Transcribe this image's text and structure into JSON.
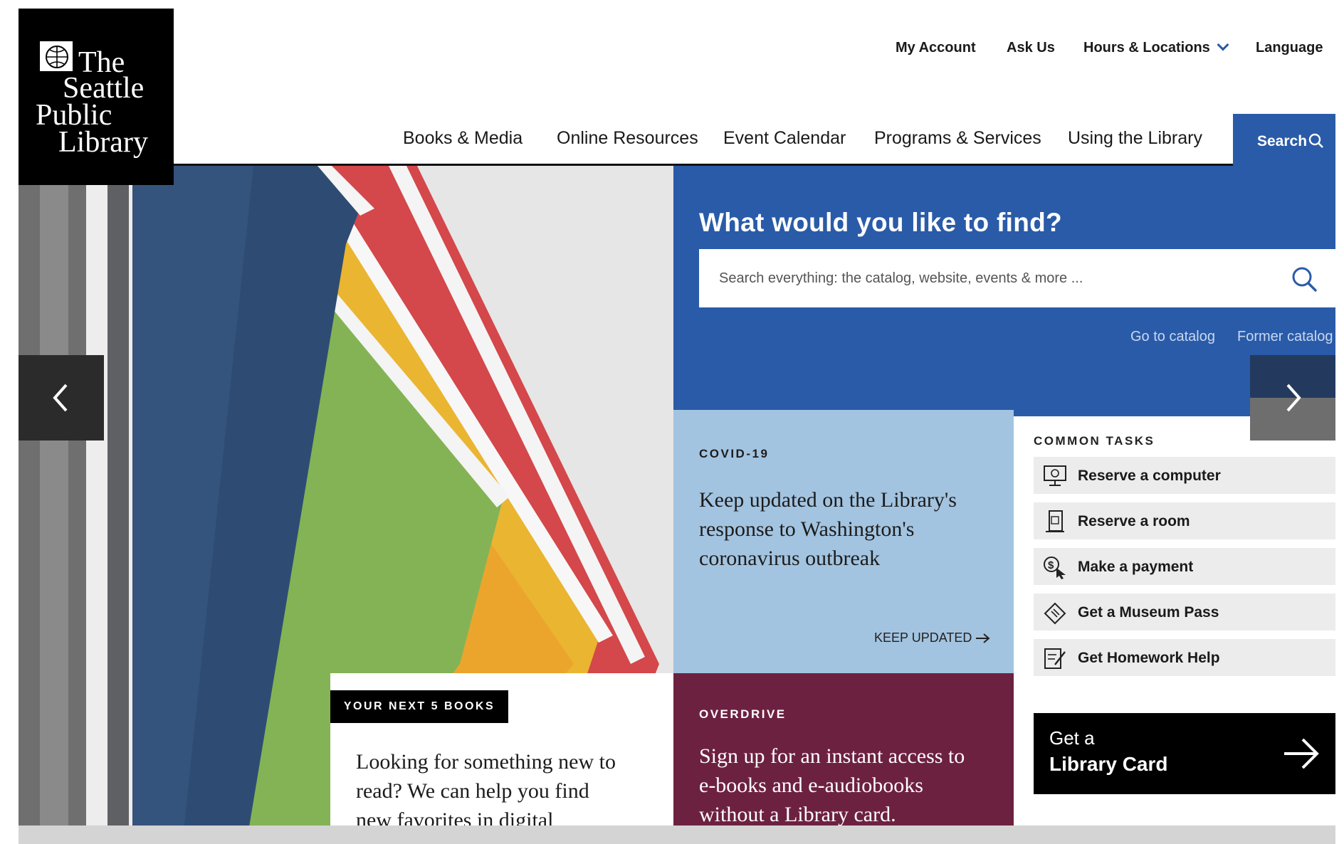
{
  "logo": {
    "lines": [
      "The",
      "Seattle",
      "Public",
      "Library"
    ]
  },
  "utility_nav": {
    "my_account": "My Account",
    "ask_us": "Ask Us",
    "hours_locations": "Hours & Locations",
    "language": "Language"
  },
  "main_nav": {
    "items": [
      "Books & Media",
      "Online Resources",
      "Event Calendar",
      "Programs & Services",
      "Using the Library"
    ],
    "search_label": "Search"
  },
  "search_panel": {
    "title": "What would you like to find?",
    "placeholder": "Search everything: the catalog, website, events & more ...",
    "go_to_catalog": "Go to catalog",
    "former_catalog": "Former catalog"
  },
  "covid": {
    "kicker": "COVID-19",
    "lines": [
      "Keep updated on the Library's",
      "response to Washington's",
      "coronavirus outbreak"
    ],
    "link": "KEEP UPDATED"
  },
  "common_tasks": {
    "title": "COMMON TASKS",
    "items": [
      {
        "label": "Reserve a computer",
        "icon": "computer-icon"
      },
      {
        "label": "Reserve a room",
        "icon": "door-icon"
      },
      {
        "label": "Make a payment",
        "icon": "payment-icon"
      },
      {
        "label": "Get a Museum Pass",
        "icon": "ticket-icon"
      },
      {
        "label": "Get Homework Help",
        "icon": "homework-icon"
      }
    ]
  },
  "library_card": {
    "line1": "Get a",
    "line2": "Library Card"
  },
  "overdrive": {
    "kicker": "OVERDRIVE",
    "lines": [
      "Sign up for an instant access to",
      "e-books and e-audiobooks",
      "without a Library card."
    ]
  },
  "next5": {
    "tag": "YOUR NEXT 5 BOOKS",
    "lines": [
      "Looking for something new to",
      "read? We can help you find",
      "new favorites in digital"
    ]
  },
  "colors": {
    "brand_blue": "#2a5ba8",
    "covid_bg": "#a3c4e0",
    "overdrive_bg": "#6d2140",
    "black": "#000000"
  }
}
